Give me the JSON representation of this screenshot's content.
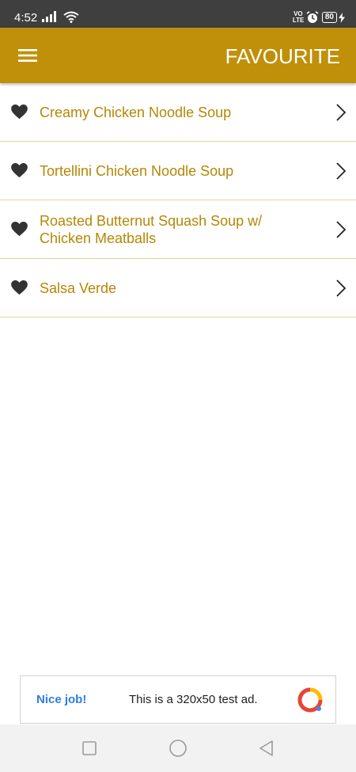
{
  "status_bar": {
    "time": "4:52",
    "network_label": "VO\nLTE",
    "battery_level": "80",
    "icons": [
      "signal-icon",
      "wifi-icon",
      "volte-icon",
      "alarm-icon",
      "battery-icon",
      "charging-icon"
    ]
  },
  "app_bar": {
    "title": "FAVOURITE",
    "menu_icon": "hamburger-menu-icon",
    "background_color": "#c0900a"
  },
  "favourites": [
    {
      "label": "Creamy Chicken Noodle Soup",
      "icon": "heart-icon",
      "action_icon": "chevron-right-icon"
    },
    {
      "label": "Tortellini Chicken Noodle Soup",
      "icon": "heart-icon",
      "action_icon": "chevron-right-icon"
    },
    {
      "label": "Roasted Butternut Squash Soup w/ Chicken Meatballs",
      "icon": "heart-icon",
      "action_icon": "chevron-right-icon"
    },
    {
      "label": "Salsa Verde",
      "icon": "heart-icon",
      "action_icon": "chevron-right-icon"
    }
  ],
  "colors": {
    "accent": "#c0900a",
    "item_text": "#b58705",
    "divider": "#e5d29a",
    "ad_link": "#2c7de8"
  },
  "ad": {
    "nice_job": "Nice job!",
    "text": "This is a 320x50 test ad.",
    "logo_icon": "ad-logo-icon"
  },
  "nav_bar": {
    "buttons": [
      "recents-square-icon",
      "home-circle-icon",
      "back-triangle-icon"
    ]
  }
}
